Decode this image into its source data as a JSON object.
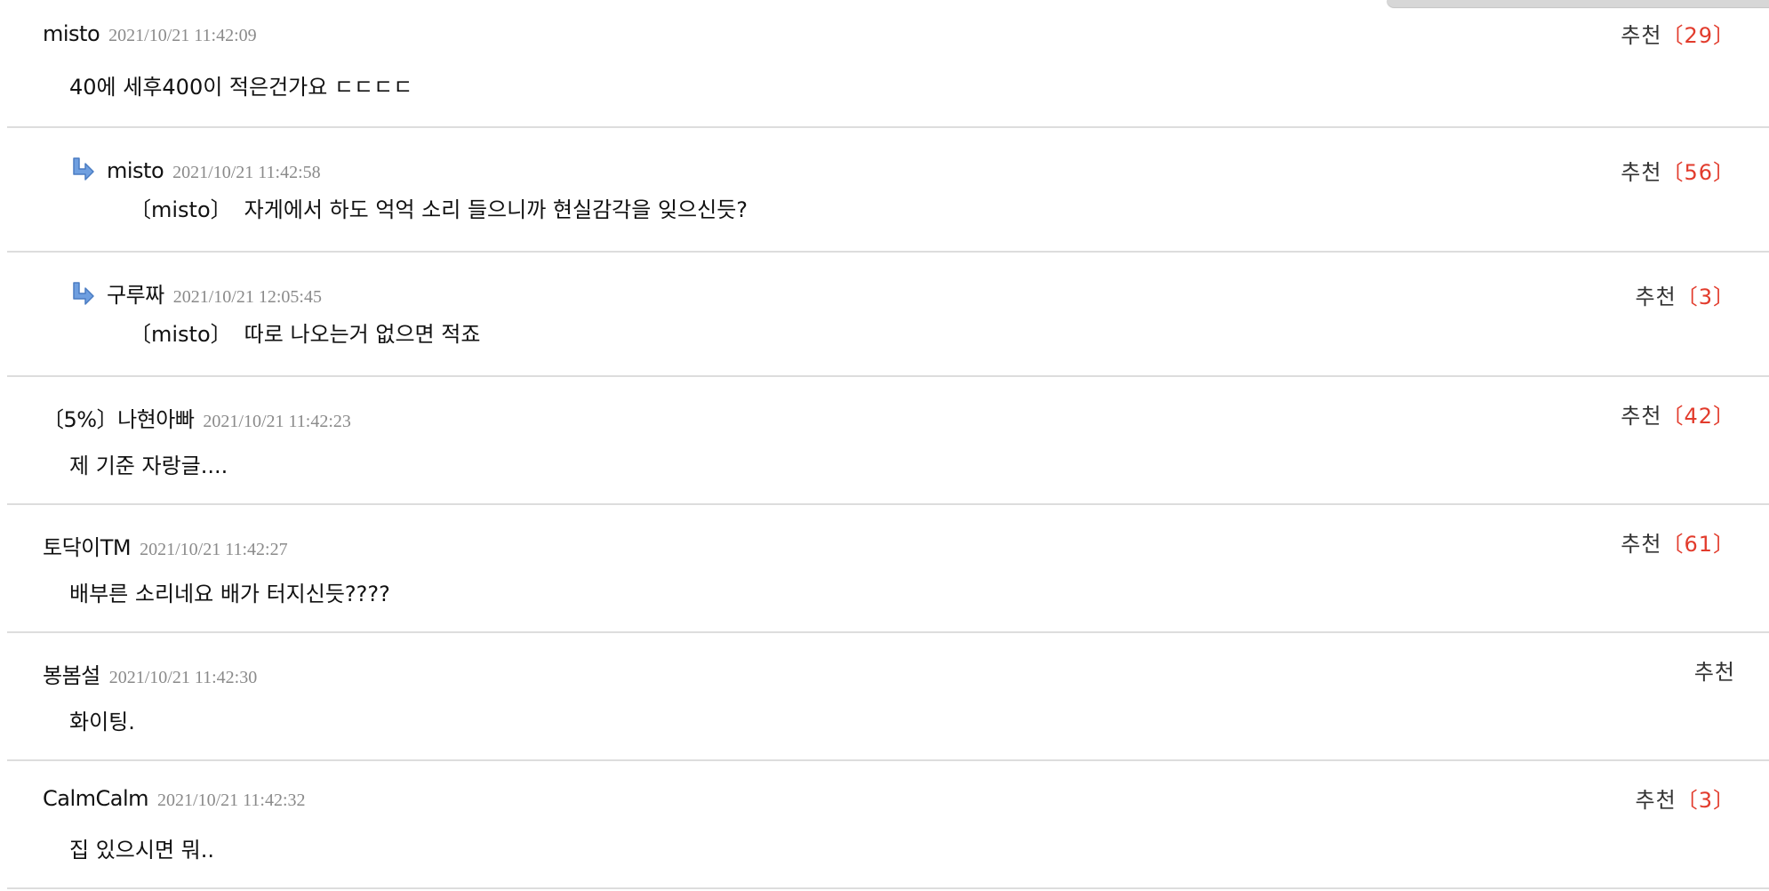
{
  "comments": [
    {
      "author": "misto",
      "date": "2021/10/21 11:42:09",
      "recommend_label": "추천",
      "recommend_count": "〔29〕",
      "mention": "",
      "text": "40에 세후400이 적은건가요 ㄷㄷㄷㄷ",
      "is_reply": false
    },
    {
      "author": "misto",
      "date": "2021/10/21 11:42:58",
      "recommend_label": "추천",
      "recommend_count": "〔56〕",
      "mention": "〔misto〕",
      "text": "자게에서 하도 억억 소리 들으니까 현실감각을 잊으신듯?",
      "is_reply": true,
      "icon": "reply-arrow-icon"
    },
    {
      "author": "구루짜",
      "date": "2021/10/21 12:05:45",
      "recommend_label": "추천",
      "recommend_count": "〔3〕",
      "mention": "〔misto〕",
      "text": "따로 나오는거 없으면 적죠",
      "is_reply": true,
      "icon": "reply-arrow-icon"
    },
    {
      "author": "〔5%〕나현아빠",
      "date": "2021/10/21 11:42:23",
      "recommend_label": "추천",
      "recommend_count": "〔42〕",
      "mention": "",
      "text": "제 기준 자랑글....",
      "is_reply": false
    },
    {
      "author": "토닥이TM",
      "date": "2021/10/21 11:42:27",
      "recommend_label": "추천",
      "recommend_count": "〔61〕",
      "mention": "",
      "text": "배부른 소리네요 배가 터지신듯????",
      "is_reply": false
    },
    {
      "author": "봉봄설",
      "date": "2021/10/21 11:42:30",
      "recommend_label": "추천",
      "recommend_count": "",
      "mention": "",
      "text": "화이팅.",
      "is_reply": false
    },
    {
      "author": "CalmCalm",
      "date": "2021/10/21 11:42:32",
      "recommend_label": "추천",
      "recommend_count": "〔3〕",
      "mention": "",
      "text": "집 있으시면 뭐..",
      "is_reply": false
    }
  ],
  "colors": {
    "recommend_count": "#e23b2c",
    "date": "#8a8a8a",
    "divider": "#dddddd",
    "reply_arrow": "#5b8fd6"
  }
}
